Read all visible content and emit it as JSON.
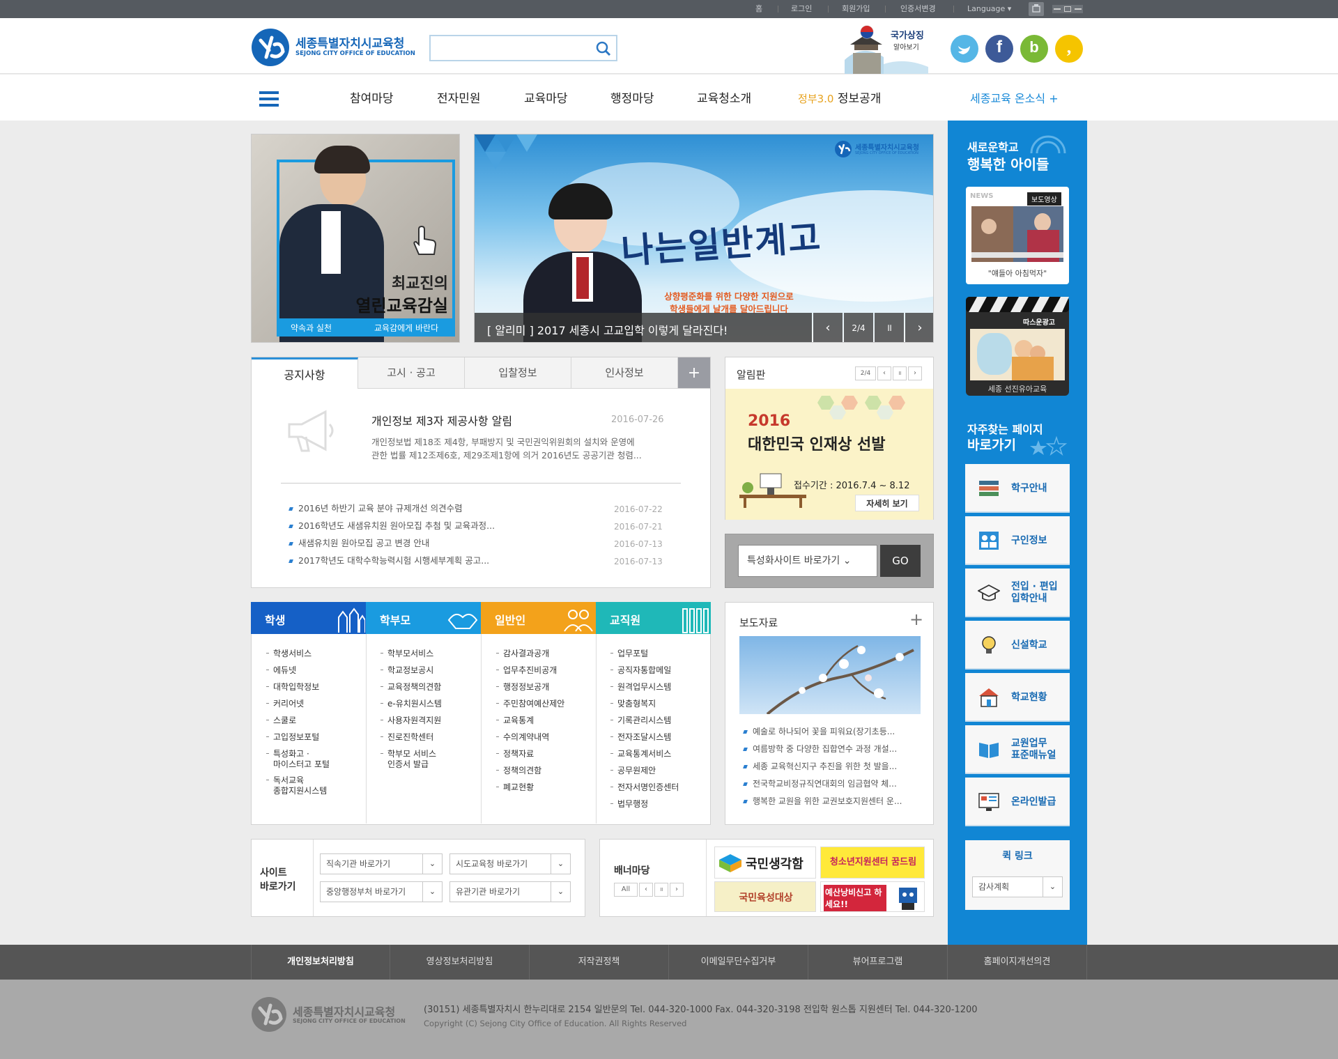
{
  "util": {
    "home": "홈",
    "login": "로그인",
    "join": "회원가입",
    "cert": "인증서변경",
    "language": "Language ▾"
  },
  "logo": {
    "kr": "세종특별자치시교육청",
    "en": "SEJONG CITY OFFICE OF EDUCATION"
  },
  "search": {
    "placeholder": ""
  },
  "symbol": {
    "line1": "국가상징",
    "line2": "알아보기"
  },
  "gnb": [
    "참여마당",
    "전자민원",
    "교육마당",
    "행정마당",
    "교육청소개"
  ],
  "gnb_gov": {
    "prefix": "정부3.0",
    "label": "정보공개"
  },
  "gnb_online": "세종교육 온소식 +",
  "promo_left": {
    "line1": "최교진의",
    "line2": "열린교육감실",
    "link1": "약속과 실천",
    "link2": "교육감에게 바란다"
  },
  "banner": {
    "logo": "세종특별자치시교육청",
    "logo_en": "SEJONG CITY OFFICE OF EDUCATION",
    "slogan": "나는일반계고",
    "sub1": "상향평준화를 위한 다양한 지원으로",
    "sub2": "학생들에게 날개를 달아드립니다",
    "caption": "[ 알리미 ] 2017 세종시 고교입학 이렇게 달라진다!",
    "page": "2/4"
  },
  "notice": {
    "tabs": [
      "공지사항",
      "고시 · 공고",
      "입찰정보",
      "인사정보"
    ],
    "more": "+",
    "feature": {
      "title": "개인정보 제3자 제공사항 알림",
      "date": "2016-07-26",
      "desc1": "개인정보법 제18조 제4항, 부패방지 및 국민권익위원회의 설치와 운영에",
      "desc2": "관한 법률 제12조제6호, 제29조제1항에 의거 2016년도 공공기관 청렴..."
    },
    "items": [
      {
        "title": "2016년 하반기 교육 분야 규제개선 의견수렴",
        "date": "2016-07-22"
      },
      {
        "title": "2016학년도 새샘유치원 원아모집 추첨 및 교육과정...",
        "date": "2016-07-21"
      },
      {
        "title": "새샘유치원 원아모집 공고 변경 안내",
        "date": "2016-07-13"
      },
      {
        "title": "2017학년도 대학수학능력시험 시행세부계획 공고...",
        "date": "2016-07-13"
      }
    ]
  },
  "alim": {
    "title": "알림판",
    "page": "2/4",
    "year": "2016",
    "headline": "대한민국 인재상 선발",
    "period": "접수기간 : 2016.7.4 ~ 8.12",
    "btn": "자세히 보기"
  },
  "special": {
    "select": "특성화사이트 바로가기 ⌄",
    "go": "GO"
  },
  "categories": [
    {
      "name": "학생",
      "color": "#1560c6",
      "items": [
        "학생서비스",
        "에듀넷",
        "대학입학정보",
        "커리어넷",
        "스쿨로",
        "고입정보포털",
        "특성화고 · \n마이스터고 포털",
        "독서교육\n종합지원시스템"
      ]
    },
    {
      "name": "학부모",
      "color": "#1a9be0",
      "items": [
        "학부모서비스",
        "학교정보공시",
        "교육정책의견함",
        "e-유치원시스템",
        "사용자원격지원",
        "진로진학센터",
        "학부모 서비스\n인증서 발급"
      ]
    },
    {
      "name": "일반인",
      "color": "#f3a21b",
      "items": [
        "감사결과공개",
        "업무추진비공개",
        "행정정보공개",
        "주민참여예산제안",
        "교육통계",
        "수의계약내역",
        "정책자료",
        "정책의견함",
        "폐교현황"
      ]
    },
    {
      "name": "교직원",
      "color": "#1fb8b8",
      "items": [
        "업무포털",
        "공직자통합메일",
        "원격업무시스템",
        "맞춤형복지",
        "기록관리시스템",
        "전자조달시스템",
        "교육통계서비스",
        "공무원제안",
        "전자서명인증센터",
        "법무행정"
      ]
    }
  ],
  "press": {
    "title": "보도자료",
    "more": "+",
    "items": [
      "예술로 하나되어 꽃을 피워요(장기초등...",
      "여름방학 중 다양한 집합연수 과정 개설...",
      "세종 교육혁신지구 추진을 위한 첫 발을...",
      "전국학교비정규직연대회의 임금협약 체...",
      "행복한 교원을 위한 교권보호지원센터 운..."
    ]
  },
  "sitego": {
    "label1": "사이트",
    "label2": "바로가기",
    "sel1": "직속기관 바로가기",
    "sel2": "시도교육청 바로가기",
    "sel3": "중앙행정부처 바로가기",
    "sel4": "유관기관 바로가기"
  },
  "bannermadang": {
    "label": "배너마당",
    "all": "All",
    "b1": "국민생각함",
    "b2": "청소년지원센터 꿈드림",
    "b3": "국민육성대상",
    "b4": "예산낭비신고 하세요!!"
  },
  "rside": {
    "top1": "새로운학교",
    "top2": "행복한 아이들",
    "news_tag": "NEWS",
    "news_label": "보도영상",
    "news_cap": "\"얘들아 아침먹자\"",
    "ad_label": "따스운광고",
    "ad_cap": "세종 선진유아교육",
    "fav1": "자주찾는 페이지",
    "fav2": "바로가기",
    "quick": [
      "학구안내",
      "구인정보",
      "전입 · 편입\n입학안내",
      "신설학교",
      "학교현황",
      "교원업무\n표준매뉴얼",
      "온라인발급"
    ],
    "quicklink": "퀵 링크",
    "quicksel": "감사계획"
  },
  "footer": {
    "links": [
      "개인정보처리방침",
      "영상정보처리방침",
      "저작권정책",
      "이메일무단수집거부",
      "뷰어프로그램",
      "홈페이지개선의견"
    ],
    "address": "(30151) 세종특별자치시 한누리대로 2154  일반문의  Tel. 044-320-1000  Fax. 044-320-3198 전입학 원스톱 지원센터  Tel. 044-320-1200",
    "copyright": "Copyright (C) Sejong City Office of Education. All Rights Reserved"
  },
  "colors": {
    "blue": "#1186d4",
    "navy": "#1560c6",
    "orange": "#f3a21b",
    "teal": "#1fb8b8"
  }
}
